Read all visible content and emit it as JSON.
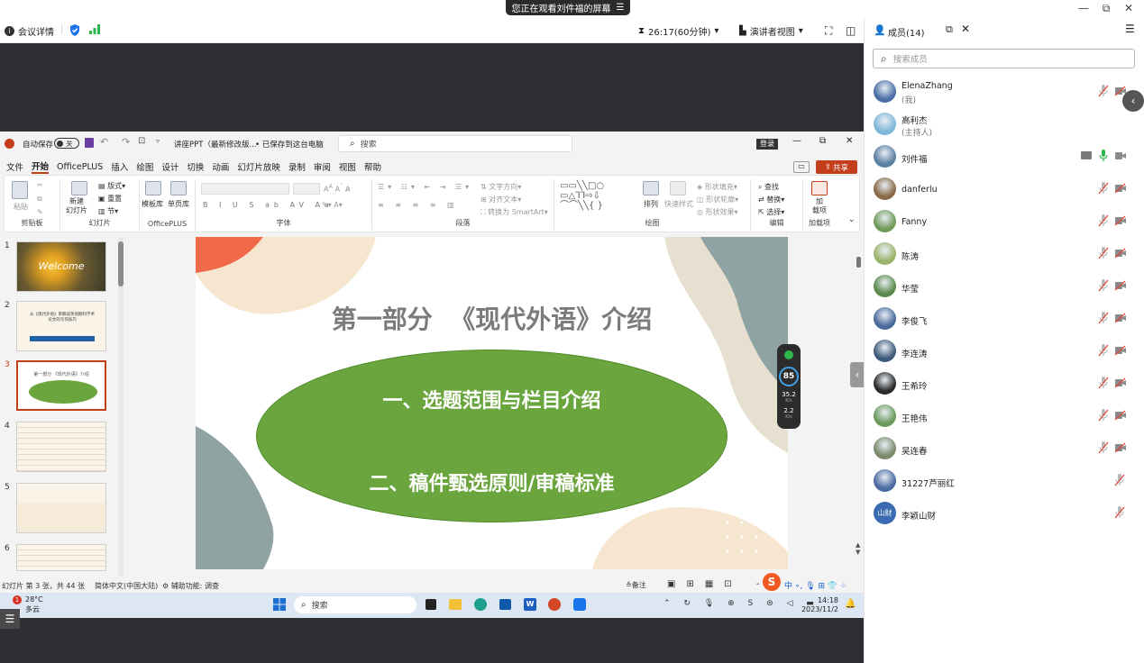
{
  "top": {
    "banner": "您正在观看刘件福的屏幕",
    "banner_icon": "menu-lines-icon"
  },
  "meeting": {
    "info_label": "会议详情",
    "timer": "26:17(60分钟)",
    "view_label": "演讲者视图"
  },
  "ppt": {
    "autosave": "自动保存",
    "autosave_state": "关",
    "filename": "讲座PPT（最新修改版...",
    "saved": "• 已保存到这台电脑",
    "search_placeholder": "搜索",
    "login": "登录",
    "share": "共享",
    "menu": [
      "文件",
      "开始",
      "OfficePLUS",
      "插入",
      "绘图",
      "设计",
      "切换",
      "动画",
      "幻灯片放映",
      "录制",
      "审阅",
      "视图",
      "帮助"
    ],
    "ribbon": {
      "paste": "粘贴",
      "clipboard": "剪贴板",
      "new_slide": "新建\n幻灯片",
      "layout": "版式",
      "reset": "重置",
      "section": "节",
      "slides": "幻灯片",
      "template": "模板库",
      "singlepage": "单页库",
      "officeplus": "OfficePLUS",
      "font": "字体",
      "text_dir": "文字方向",
      "align_text": "对齐文本",
      "smartart": "转换为 SmartArt",
      "paragraph": "段落",
      "arrange": "排列",
      "quick_style": "快速样式",
      "shape_fill": "形状填充",
      "shape_outline": "形状轮廓",
      "shape_effect": "形状效果",
      "drawing": "绘图",
      "find": "查找",
      "replace": "替换",
      "select": "选择",
      "editing": "编辑",
      "addin": "加\n载项",
      "addins": "加载项"
    },
    "thumbs": [
      {
        "num": "1",
        "text": "Welcome"
      },
      {
        "num": "2",
        "text": "从《现代外语》审稿谈英语期刊学术论文的写作技巧"
      },
      {
        "num": "3",
        "text": "第一部分 《现代外语》介绍"
      },
      {
        "num": "4",
        "text": ""
      },
      {
        "num": "5",
        "text": ""
      },
      {
        "num": "6",
        "text": ""
      }
    ],
    "slide": {
      "title": "第一部分  《现代外语》介绍",
      "line1": "一、选题范围与栏目介绍",
      "line2": "二、稿件甄选原则/审稿标准",
      "ellipse_color": "#6aa63d"
    },
    "status": {
      "slide_info": "幻灯片 第 3 张，共 44 张",
      "lang": "简体中文(中国大陆)",
      "access": "辅助功能: 调查",
      "notes": "备注"
    },
    "perf": {
      "score": "85",
      "up": "35.2",
      "down": "2.2",
      "unit": "K/s"
    },
    "taskbar": {
      "temp": "28°C",
      "weather": "多云",
      "notif_count": "1",
      "search": "搜索",
      "time": "14:18",
      "date": "2023/11/2"
    }
  },
  "panel": {
    "title": "成员(14)",
    "search_placeholder": "搜索成员",
    "members": [
      {
        "name": "ElenaZhang",
        "role": "(我)",
        "color": "#4b6fa5",
        "mic": "muted",
        "cam": "off"
      },
      {
        "name": "高利杰",
        "role": "(主持人)",
        "color": "#7fb7d8",
        "mic": "none",
        "cam": "none"
      },
      {
        "name": "刘件福",
        "role": "",
        "color": "#5a7fa0",
        "mic": "on",
        "cam": "on"
      },
      {
        "name": "danferlu",
        "role": "",
        "color": "#8a6a4a",
        "mic": "muted",
        "cam": "off"
      },
      {
        "name": "Fanny",
        "role": "",
        "color": "#6f9a5a",
        "mic": "muted",
        "cam": "off"
      },
      {
        "name": "陈涛",
        "role": "",
        "color": "#9ab36a",
        "mic": "muted",
        "cam": "off"
      },
      {
        "name": "华莹",
        "role": "",
        "color": "#5a8a4a",
        "mic": "muted",
        "cam": "off"
      },
      {
        "name": "李俊飞",
        "role": "",
        "color": "#4a6a9a",
        "mic": "muted",
        "cam": "off"
      },
      {
        "name": "李连涛",
        "role": "",
        "color": "#3e5a7a",
        "mic": "muted",
        "cam": "off"
      },
      {
        "name": "王希玲",
        "role": "",
        "color": "#2a2a2a",
        "mic": "muted",
        "cam": "off"
      },
      {
        "name": "王艳伟",
        "role": "",
        "color": "#6a9a5a",
        "mic": "muted",
        "cam": "off"
      },
      {
        "name": "吴连春",
        "role": "",
        "color": "#7a8a6a",
        "mic": "muted",
        "cam": "off"
      },
      {
        "name": "31227芦丽红",
        "role": "",
        "color": "#4a6aa0",
        "mic": "muted",
        "cam": "none"
      },
      {
        "name": "李颖山财",
        "role": "",
        "color": "#3a6ab0",
        "mic": "muted",
        "cam": "none",
        "avatar_text": "山财"
      }
    ]
  }
}
